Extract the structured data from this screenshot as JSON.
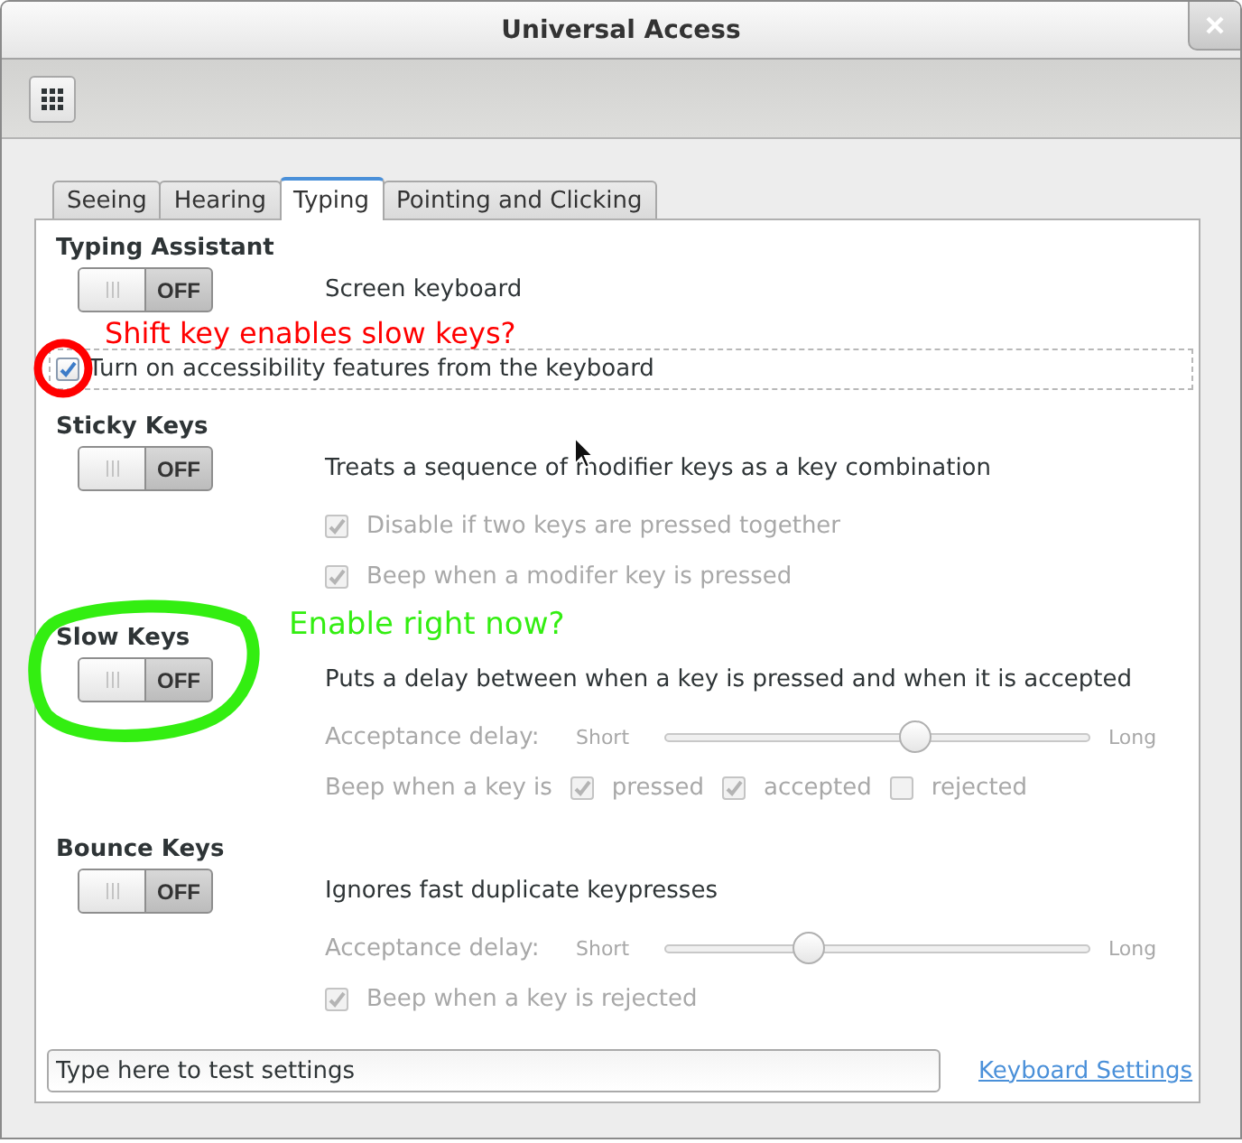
{
  "window": {
    "title": "Universal Access"
  },
  "tabs": [
    {
      "label": "Seeing",
      "selected": false
    },
    {
      "label": "Hearing",
      "selected": false
    },
    {
      "label": "Typing",
      "selected": true
    },
    {
      "label": "Pointing and Clicking",
      "selected": false
    }
  ],
  "sections": [
    {
      "heading": "Typing Assistant",
      "switch": {
        "label": "OFF",
        "on": false
      },
      "description": "Screen keyboard",
      "shortcut": {
        "label": "Turn on accessibility features from the keyboard",
        "checked": true,
        "focused": true,
        "annotation": {
          "text": "Shift key enables slow keys?",
          "color": "#ff0000"
        }
      }
    },
    {
      "heading": "Sticky Keys",
      "switch": {
        "label": "OFF",
        "on": false
      },
      "description": "Treats a sequence of modifier keys as a key combination",
      "options": [
        {
          "kind": "checkbox",
          "label": "Disable if two keys are pressed together",
          "checked": true,
          "disabled": true
        },
        {
          "kind": "checkbox",
          "label": "Beep when a modifer key is pressed",
          "checked": true,
          "disabled": true
        }
      ]
    },
    {
      "heading": "Slow Keys",
      "switch": {
        "label": "OFF",
        "on": false
      },
      "description": "Puts a delay between when a key is pressed and when it is accepted",
      "annotation": {
        "text": "Enable right now?",
        "color": "#33ee11"
      },
      "options": [
        {
          "kind": "slider",
          "label": "Acceptance delay:",
          "min_label": "Short",
          "max_label": "Long",
          "level": 0.59,
          "disabled": true
        },
        {
          "kind": "checkgroup",
          "label": "Beep when a key is",
          "disabled": true,
          "items": [
            {
              "label": "pressed",
              "checked": true
            },
            {
              "label": "accepted",
              "checked": true
            },
            {
              "label": "rejected",
              "checked": false
            }
          ]
        }
      ]
    },
    {
      "heading": "Bounce Keys",
      "switch": {
        "label": "OFF",
        "on": false
      },
      "description": "Ignores fast duplicate keypresses",
      "options": [
        {
          "kind": "slider",
          "label": "Acceptance delay:",
          "min_label": "Short",
          "max_label": "Long",
          "level": 0.34,
          "disabled": true
        },
        {
          "kind": "checkbox",
          "label": "Beep when a key is rejected",
          "checked": true,
          "disabled": true
        }
      ]
    }
  ],
  "test_field": {
    "placeholder": "Type here to test settings"
  },
  "link": "Keyboard Settings"
}
